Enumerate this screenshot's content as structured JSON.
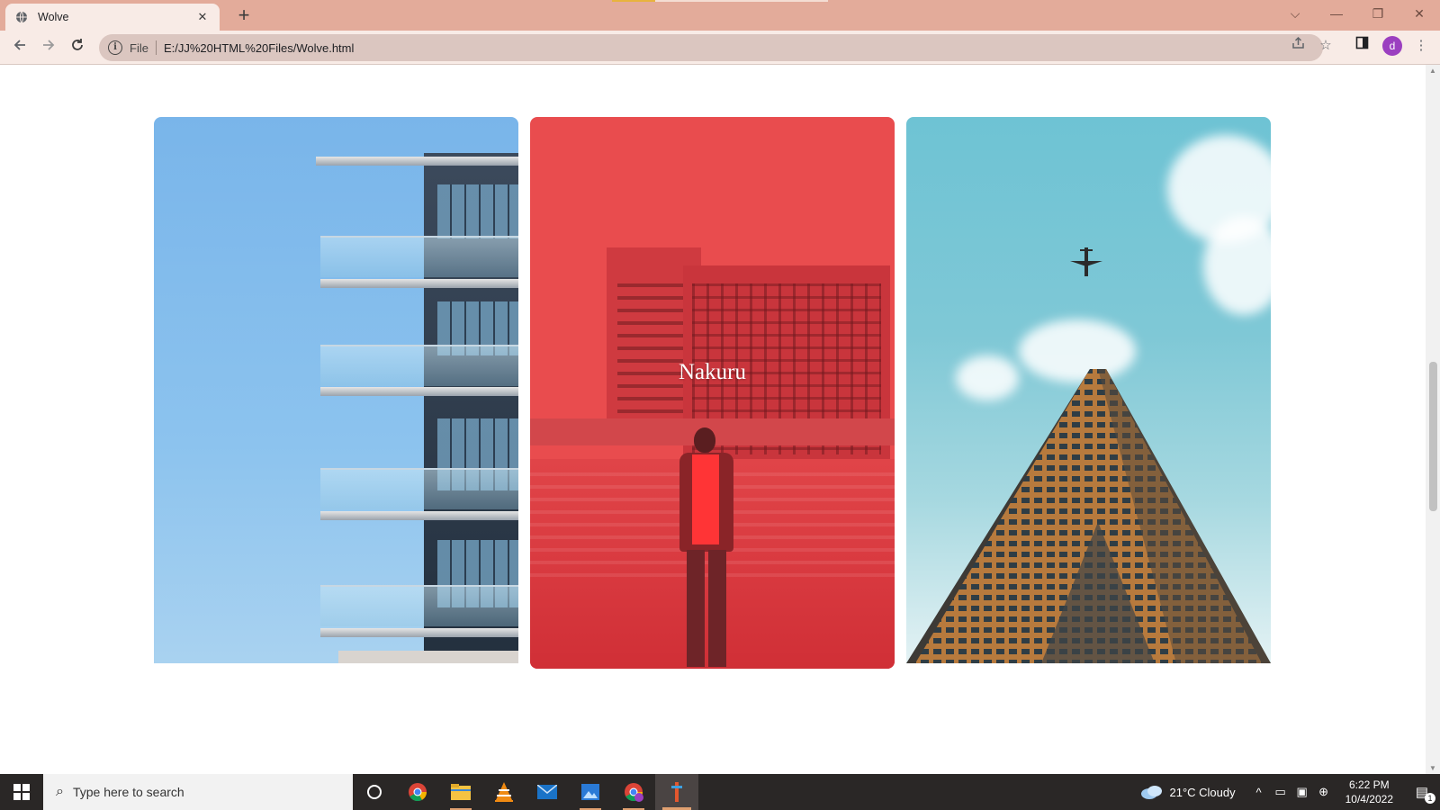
{
  "browser": {
    "tab_title": "Wolve",
    "new_tab_label": "+",
    "tab_close_label": "✕",
    "scheme_label": "File",
    "url": "E:/JJ%20HTML%20Files/Wolve.html",
    "profile_initial": "d",
    "window_controls": {
      "tab_search": "⌵",
      "minimize": "—",
      "restore": "❐",
      "close": "✕"
    }
  },
  "page": {
    "cards": [
      {
        "name": "balcony-building-card",
        "label": ""
      },
      {
        "name": "nakuru-card",
        "label": "Nakuru",
        "overlay_color": "#e94c4e"
      },
      {
        "name": "skyscraper-card",
        "label": ""
      }
    ]
  },
  "taskbar": {
    "search_placeholder": "Type here to search",
    "weather": "21°C  Cloudy",
    "time": "6:22 PM",
    "date": "10/4/2022",
    "notification_count": "1",
    "apps": [
      "task-view",
      "chrome",
      "file-explorer",
      "vlc",
      "mail",
      "photos",
      "chrome-profile",
      "editor"
    ]
  },
  "colors": {
    "tabstrip": "#e3ab9a",
    "toolbar": "#f8ebe6",
    "accent_red": "#e94c4e",
    "avatar": "#9b3fc0"
  }
}
